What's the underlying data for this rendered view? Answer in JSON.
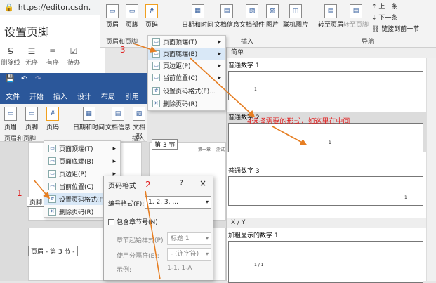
{
  "browser": {
    "url": "https://editor.csdn.",
    "page_title": "设置页脚",
    "tools": [
      "删除线",
      "无序",
      "有序",
      "待办"
    ]
  },
  "top_ribbon": {
    "buttons": {
      "header": "页眉",
      "footer": "页脚",
      "page_number": "页码",
      "datetime": "日期和时间",
      "docinfo": "文档信息",
      "docparts": "文档部件",
      "picture": "图片",
      "online_pic": "联机图片",
      "goto_header": "转至页眉",
      "goto_footer": "转至页脚",
      "prev": "上一条",
      "next": "下一条",
      "link_prev": "链接到前一节"
    },
    "groups": {
      "hf": "页眉和页脚",
      "insert": "插入",
      "nav": "导航"
    },
    "page_number_icon": "#"
  },
  "menu_top": {
    "items": [
      {
        "label": "页面顶端(T)",
        "icon": "page-top-icon"
      },
      {
        "label": "页面底端(B)",
        "icon": "page-bottom-icon"
      },
      {
        "label": "页边距(P)",
        "icon": "margin-icon"
      },
      {
        "label": "当前位置(C)",
        "icon": "current-pos-icon"
      },
      {
        "label": "设置页码格式(F)...",
        "icon": "format-icon"
      },
      {
        "label": "删除页码(R)",
        "icon": "delete-icon"
      }
    ]
  },
  "gallery": {
    "section1": "简单",
    "item1": "普通数字 1",
    "item2": "普通数字 2",
    "item3": "普通数字 3",
    "section2": "X / Y",
    "item4": "加粗显示的数字 1",
    "num": "1",
    "num_xy": "1 / 1",
    "annotation": "4选择需要的形式，如这里在中间"
  },
  "word2": {
    "tabs": [
      "文件",
      "开始",
      "插入",
      "设计",
      "布局",
      "引用"
    ],
    "buttons": {
      "header": "页眉",
      "footer": "页脚",
      "page_number": "页码",
      "datetime": "日期和时间",
      "docinfo": "文档信息",
      "docparts": "文档部"
    },
    "groups": {
      "hf": "页眉和页脚",
      "insert": "插入"
    },
    "page_number_icon": "#"
  },
  "doc": {
    "sec_label": "第 3 节",
    "footer_tag": "页眉 - 第 3 节 -",
    "left_tag": "页脚",
    "tag_page1": "第一章",
    "tag_page2": "测试"
  },
  "menu_mid": {
    "items": [
      {
        "label": "页面顶端(T)"
      },
      {
        "label": "页面底端(B)"
      },
      {
        "label": "页边距(P)"
      },
      {
        "label": "当前位置(C)"
      },
      {
        "label": "设置页码格式(F)..."
      },
      {
        "label": "删除页码(R)"
      }
    ]
  },
  "dialog": {
    "title": "页码格式",
    "help": "?",
    "close": "×",
    "format_label": "编号格式(F):",
    "format_value": "1, 2, 3, ...",
    "include_chapter": "包含章节号(N)",
    "chapter_style_label": "章节起始样式(P)",
    "chapter_style_value": "标题 1",
    "separator_label": "使用分隔符(E):",
    "separator_value": "- (连字符)",
    "example_label": "示例:",
    "example_value": "1-1, 1-A"
  },
  "steps": {
    "s1": "1",
    "s2": "2",
    "s3": "3"
  },
  "colors": {
    "accent": "#2b579a",
    "annotation": "#e02020",
    "highlight": "#d9e8f7"
  }
}
